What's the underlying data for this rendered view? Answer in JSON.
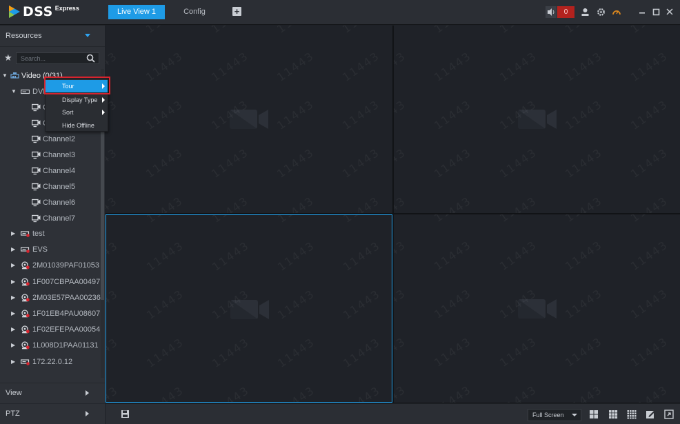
{
  "app": {
    "logo_text": "DSS",
    "logo_sub": "Express"
  },
  "tabs": [
    {
      "label": "Live View 1",
      "active": true
    },
    {
      "label": "Config",
      "active": false
    }
  ],
  "add_tab_symbol": "+",
  "alarm": {
    "count": "0"
  },
  "top_icons": [
    "speaker-icon",
    "download-icon",
    "gear-icon",
    "gauge-icon",
    "minimize-icon",
    "maximize-icon",
    "close-icon"
  ],
  "resources": {
    "title": "Resources",
    "search_placeholder": "Search..."
  },
  "tree": {
    "root": {
      "label": "Video (0/31)"
    },
    "device": {
      "label": "DVR"
    },
    "channels": [
      "Channel0",
      "Channel1",
      "Channel2",
      "Channel3",
      "Channel4",
      "Channel5",
      "Channel6",
      "Channel7"
    ],
    "devices": [
      {
        "label": "test",
        "type": "dvr"
      },
      {
        "label": "EVS",
        "type": "dvr"
      },
      {
        "label": "2M01039PAF01053",
        "type": "ipc"
      },
      {
        "label": "1F007CBPAA00497",
        "type": "ipc"
      },
      {
        "label": "2M03E57PAA00236",
        "type": "ipc"
      },
      {
        "label": "1F01EB4PAU08607",
        "type": "ipc"
      },
      {
        "label": "1F02EFEPAA00054",
        "type": "ipc"
      },
      {
        "label": "1L008D1PAA01131",
        "type": "ipc"
      },
      {
        "label": "172.22.0.12",
        "type": "dvr"
      }
    ]
  },
  "context_menu": {
    "items": [
      {
        "label": "Tour",
        "submenu": true,
        "highlighted": true
      },
      {
        "label": "Display Type",
        "submenu": true,
        "highlighted": false
      },
      {
        "label": "Sort",
        "submenu": true,
        "highlighted": false
      },
      {
        "label": "Hide Offline",
        "submenu": false,
        "highlighted": false
      }
    ]
  },
  "bottom_tabs": [
    {
      "label": "View"
    },
    {
      "label": "PTZ"
    }
  ],
  "watermark": "11443",
  "bottombar": {
    "screen_mode": "Full Screen",
    "layout_icons": [
      "layout-4-icon",
      "layout-6-icon",
      "layout-9-icon",
      "edit-layout-icon",
      "fullscreen-icon"
    ]
  },
  "colors": {
    "accent": "#1e9be6",
    "selected_border": "#26a7f4",
    "alarm_red": "#b3221e",
    "highlight_box": "#d8242e"
  }
}
